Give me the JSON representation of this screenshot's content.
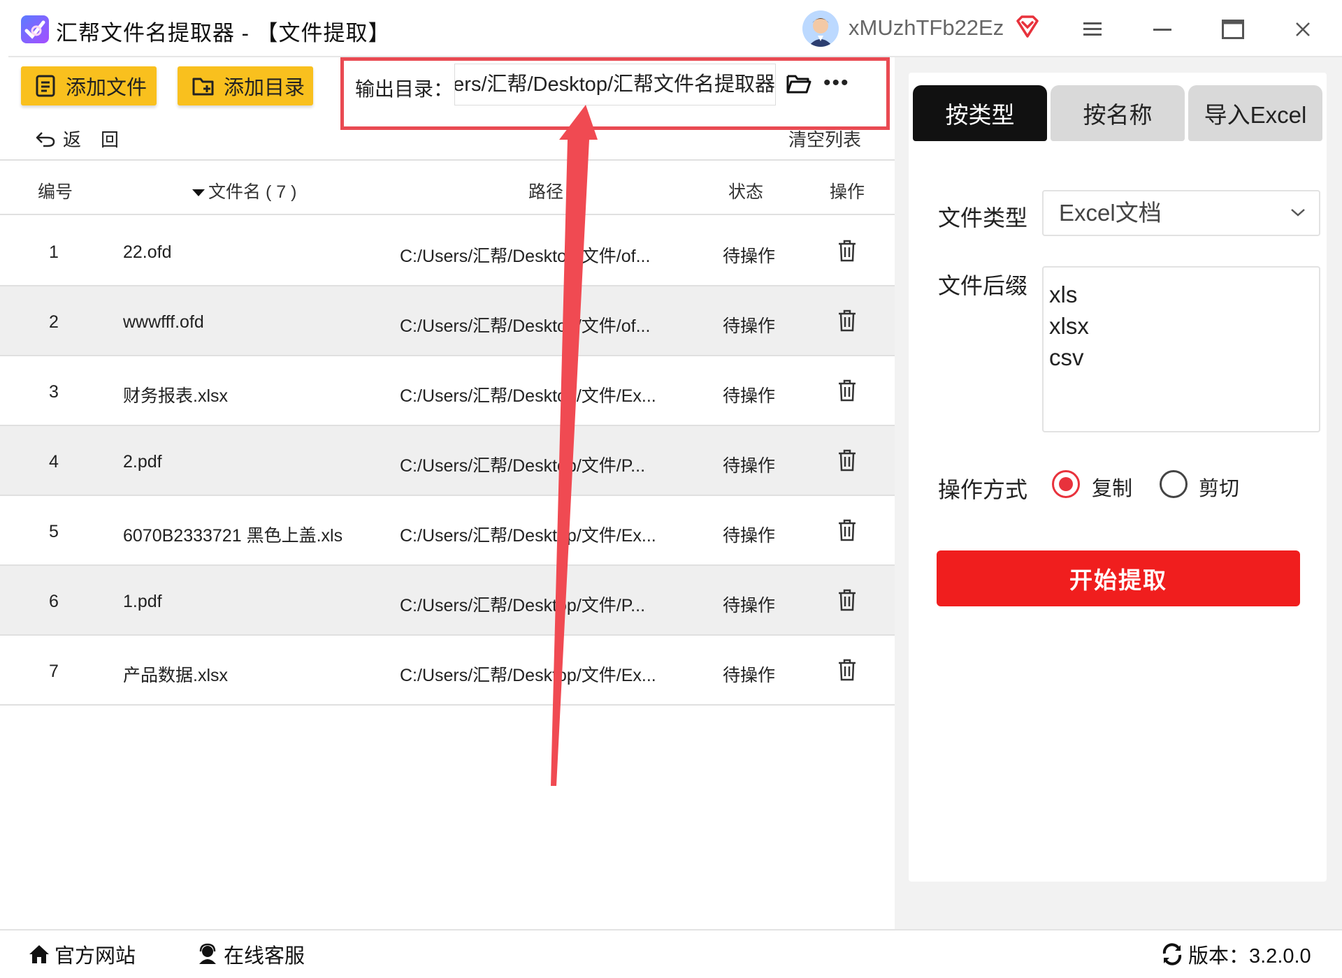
{
  "window": {
    "title": "汇帮文件名提取器 - 【文件提取】",
    "username": "xMUzhTFb22Ez"
  },
  "toolbar": {
    "add_file": "添加文件",
    "add_dir": "添加目录",
    "output_label": "输出目录：",
    "output_path": "C:/Users/汇帮/Desktop/汇帮文件名提取器",
    "more": "•••",
    "back": "返回",
    "clear_list": "清空列表"
  },
  "table": {
    "headers": {
      "no": "编号",
      "name": "文件名 ( 7 )",
      "path": "路径",
      "status": "状态",
      "op": "操作"
    },
    "rows": [
      {
        "no": "1",
        "name": "22.ofd",
        "path": "C:/Users/汇帮/Desktop/文件/of...",
        "status": "待操作"
      },
      {
        "no": "2",
        "name": "wwwfff.ofd",
        "path": "C:/Users/汇帮/Desktop/文件/of...",
        "status": "待操作"
      },
      {
        "no": "3",
        "name": "财务报表.xlsx",
        "path": "C:/Users/汇帮/Desktop/文件/Ex...",
        "status": "待操作"
      },
      {
        "no": "4",
        "name": "2.pdf",
        "path": "C:/Users/汇帮/Desktop/文件/P...",
        "status": "待操作"
      },
      {
        "no": "5",
        "name": "6070B2333721 黑色上盖.xls",
        "path": "C:/Users/汇帮/Desktop/文件/Ex...",
        "status": "待操作"
      },
      {
        "no": "6",
        "name": "1.pdf",
        "path": "C:/Users/汇帮/Desktop/文件/P...",
        "status": "待操作"
      },
      {
        "no": "7",
        "name": "产品数据.xlsx",
        "path": "C:/Users/汇帮/Desktop/文件/Ex...",
        "status": "待操作"
      }
    ]
  },
  "panel": {
    "tabs": [
      "按类型",
      "按名称",
      "导入Excel"
    ],
    "active_tab": "按类型",
    "file_type_label": "文件类型",
    "file_type_value": "Excel文档",
    "suffix_label": "文件后缀",
    "suffixes": [
      "xls",
      "xlsx",
      "csv"
    ],
    "op_mode_label": "操作方式",
    "op_copy": "复制",
    "op_cut": "剪切",
    "op_selected": "复制",
    "start": "开始提取"
  },
  "footer": {
    "website": "官方网站",
    "support": "在线客服",
    "version": "版本：3.2.0.0"
  },
  "colors": {
    "accent_yellow": "#f9c01e",
    "primary_red": "#f01e1e",
    "highlight_red": "#e94a52",
    "tab_active": "#111111"
  }
}
